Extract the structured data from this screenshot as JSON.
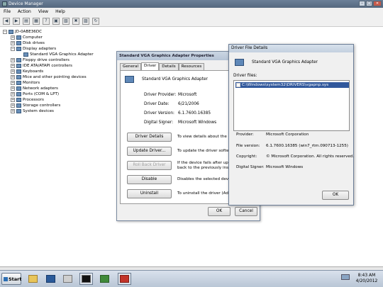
{
  "device_manager": {
    "title": "Device Manager",
    "menu": [
      "File",
      "Action",
      "View",
      "Help"
    ],
    "toolbar_icons": [
      "back-icon",
      "forward-icon",
      "properties-icon",
      "scan-icon",
      "help-icon",
      "update-icon",
      "uninstall-icon",
      "disable-icon",
      "scan-hardware-icon",
      "refresh-icon"
    ],
    "tree": [
      {
        "label": "JD-0ABE36DC",
        "expander": "−"
      },
      {
        "label": "Computer",
        "expander": "+"
      },
      {
        "label": "Disk drives",
        "expander": "+"
      },
      {
        "label": "Display adapters",
        "expander": "−"
      },
      {
        "label": "Standard VGA Graphics Adapter",
        "expander": ""
      },
      {
        "label": "Floppy drive controllers",
        "expander": "+"
      },
      {
        "label": "IDE ATA/ATAPI controllers",
        "expander": "+"
      },
      {
        "label": "Keyboards",
        "expander": "+"
      },
      {
        "label": "Mice and other pointing devices",
        "expander": "+"
      },
      {
        "label": "Monitors",
        "expander": "+"
      },
      {
        "label": "Network adapters",
        "expander": "+"
      },
      {
        "label": "Ports (COM & LPT)",
        "expander": "+"
      },
      {
        "label": "Processors",
        "expander": "+"
      },
      {
        "label": "Storage controllers",
        "expander": "+"
      },
      {
        "label": "System devices",
        "expander": "+"
      }
    ]
  },
  "properties_dialog": {
    "title": "Standard VGA Graphics Adapter Properties",
    "tabs": [
      "General",
      "Driver",
      "Details",
      "Resources"
    ],
    "active_tab": "Driver",
    "device_name": "Standard VGA Graphics Adapter",
    "info": [
      {
        "label": "Driver Provider:",
        "value": "Microsoft"
      },
      {
        "label": "Driver Date:",
        "value": "6/21/2006"
      },
      {
        "label": "Driver Version:",
        "value": "6.1.7600.16385"
      },
      {
        "label": "Digital Signer:",
        "value": "Microsoft Windows"
      }
    ],
    "buttons": [
      {
        "label": "Driver Details",
        "desc1": "To view details about the driver",
        "desc2": "",
        "disabled": false
      },
      {
        "label": "Update Driver...",
        "desc1": "To update the driver software fo",
        "desc2": "",
        "disabled": false
      },
      {
        "label": "Roll Back Driver",
        "desc1": "If the device fails after updating",
        "desc2": "back to the previously installed",
        "disabled": true
      },
      {
        "label": "Disable",
        "desc1": "Disables the selected device.",
        "desc2": "",
        "disabled": false
      },
      {
        "label": "Uninstall",
        "desc1": "To uninstall the driver (Advance",
        "desc2": "",
        "disabled": false
      }
    ],
    "ok_label": "OK",
    "cancel_label": "Cancel"
  },
  "driver_file_details": {
    "title": "Driver File Details",
    "device_name": "Standard VGA Graphics Adapter",
    "files_label": "Driver files:",
    "files": [
      "C:\\Windows\\system32\\DRIVERS\\vgapnp.sys"
    ],
    "details": [
      {
        "label": "Provider:",
        "value": "Microsoft Corporation"
      },
      {
        "label": "File version:",
        "value": "6.1.7600.16385 (win7_rtm.090713-1255)"
      },
      {
        "label": "Copyright:",
        "value": "© Microsoft Corporation. All rights reserved."
      },
      {
        "label": "Digital Signer:",
        "value": "Microsoft Windows"
      }
    ],
    "ok_label": "OK"
  },
  "taskbar": {
    "start_label": "Start",
    "apps": [
      "explorer-icon",
      "powershell-icon",
      "command-prompt-icon",
      "server-manager-icon",
      "toolbox-icon"
    ],
    "time": "8:43 AM",
    "date": "4/20/2012"
  }
}
